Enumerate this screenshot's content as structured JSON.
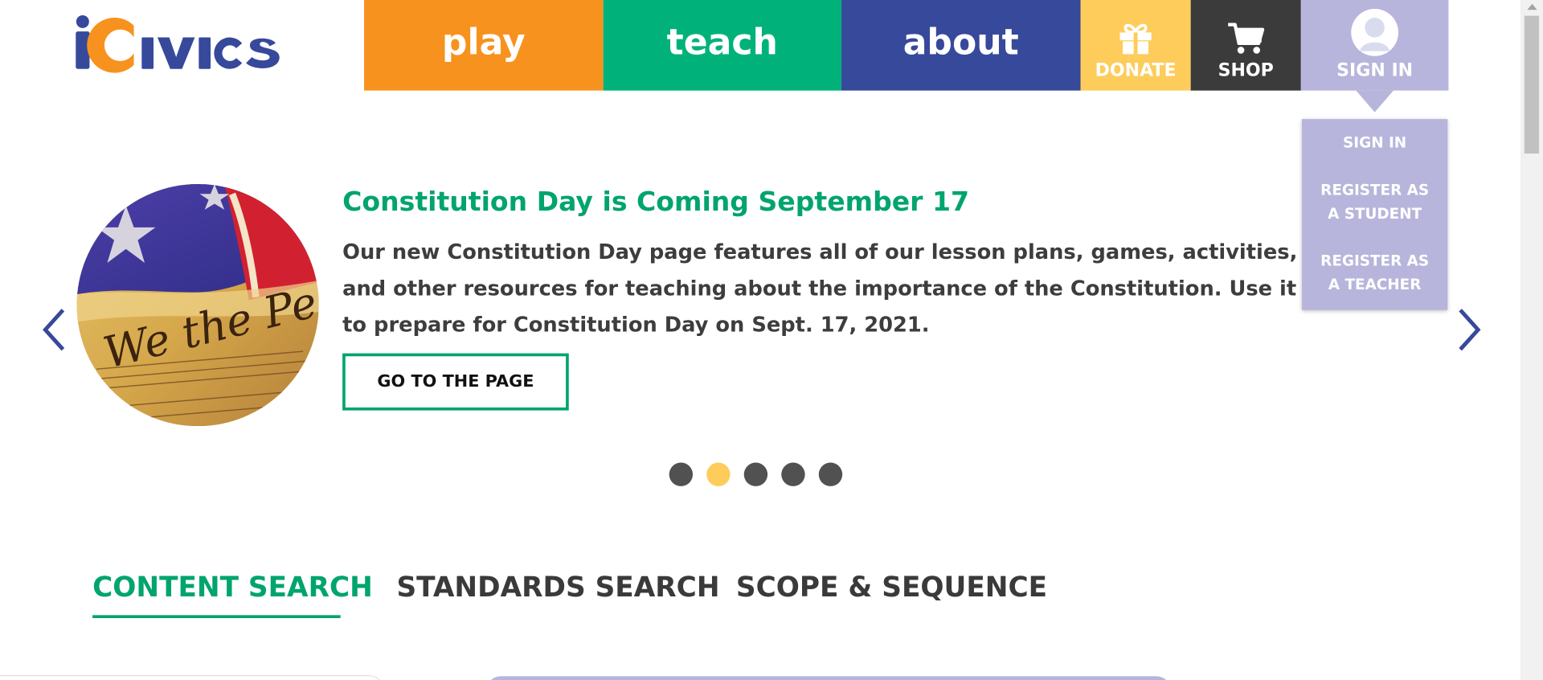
{
  "brand": {
    "logo_alt": "iCivics",
    "colors": {
      "orange": "#f7921e",
      "green": "#00b27a",
      "navy": "#37499b",
      "yellow": "#fdcc5b",
      "dark": "#3b3b3b",
      "lavender": "#b7b5db",
      "title_green": "#00a46e"
    }
  },
  "nav": {
    "play": "play",
    "teach": "teach",
    "about": "about",
    "donate": {
      "label": "DONATE",
      "icon": "gift-icon"
    },
    "shop": {
      "label": "SHOP",
      "icon": "cart-icon"
    },
    "signin": {
      "label": "SIGN IN",
      "icon": "avatar-icon"
    }
  },
  "signin_menu": {
    "items": [
      "SIGN IN",
      "REGISTER AS A STUDENT",
      "REGISTER AS A TEACHER"
    ]
  },
  "carousel": {
    "title": "Constitution Day is Coming September 17",
    "text": "Our new Constitution Day page features all of our lesson plans, games, activities, and other resources for teaching about the importance of the Constitution. Use it to prepare for Constitution Day on Sept. 17, 2021.",
    "button": "GO TO THE PAGE",
    "active_slide": 2,
    "slide_count": 5,
    "prev_icon": "chevron-left-icon",
    "next_icon": "chevron-right-icon"
  },
  "tabs": {
    "items": [
      "CONTENT SEARCH",
      "STANDARDS SEARCH",
      "SCOPE & SEQUENCE"
    ],
    "active": "CONTENT SEARCH"
  }
}
